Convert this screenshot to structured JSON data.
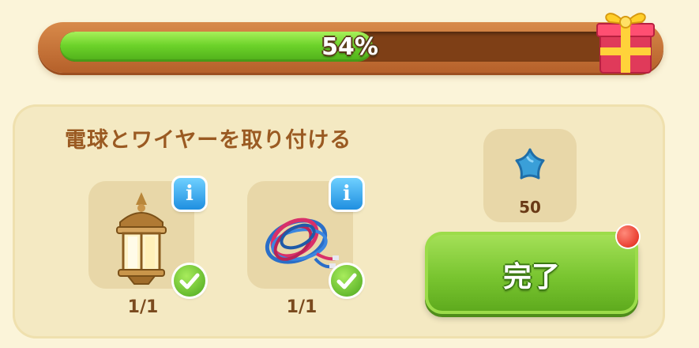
{
  "progress": {
    "percent": 54,
    "label": "54%"
  },
  "task": {
    "title": "電球とワイヤーを取り付ける",
    "items": [
      {
        "name": "lantern",
        "count": "1/1",
        "completed": true
      },
      {
        "name": "wire-bundle",
        "count": "1/1",
        "completed": true
      }
    ]
  },
  "reward": {
    "icon": "star-icon",
    "amount": "50"
  },
  "complete_button": {
    "label": "完了",
    "notification": true
  },
  "colors": {
    "progress_fill": "#6dd32a",
    "progress_frame": "#c77538",
    "panel": "#f4e9c2",
    "button": "#79c530",
    "title_text": "#9a5a22"
  }
}
